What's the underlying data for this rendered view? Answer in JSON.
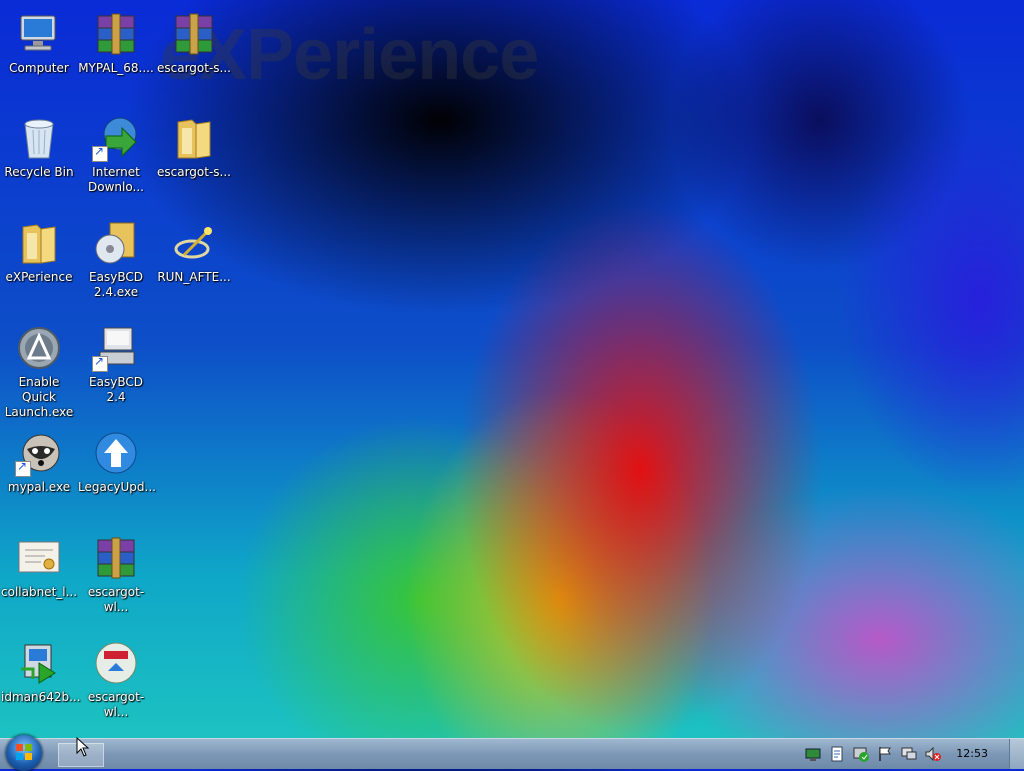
{
  "desktop": {
    "watermark": "eXPerience",
    "icons": [
      {
        "label": "Computer",
        "icon": "computer-icon"
      },
      {
        "label": "MYPAL_68....",
        "icon": "winrar-archive-icon"
      },
      {
        "label": "escargot-s...",
        "icon": "winrar-archive-icon"
      },
      {
        "label": "Recycle Bin",
        "icon": "recycle-bin-icon"
      },
      {
        "label": "Internet Downlo...",
        "icon": "internet-download-manager-icon"
      },
      {
        "label": "escargot-s...",
        "icon": "folder-icon"
      },
      {
        "label": "eXPerience",
        "icon": "folder-icon"
      },
      {
        "label": "EasyBCD 2.4.exe",
        "icon": "easybcd-installer-icon"
      },
      {
        "label": "RUN_AFTE...",
        "icon": "script-icon"
      },
      {
        "label": "Enable Quick Launch.exe",
        "icon": "quick-launch-icon"
      },
      {
        "label": "EasyBCD 2.4",
        "icon": "easybcd-icon"
      },
      {
        "label": "mypal.exe",
        "icon": "mypal-icon"
      },
      {
        "label": "LegacyUpd...",
        "icon": "legacy-update-icon"
      },
      {
        "label": "collabnet_l...",
        "icon": "certificate-icon"
      },
      {
        "label": "escargot-wl...",
        "icon": "winrar-archive-icon"
      },
      {
        "label": "idman642b...",
        "icon": "idm-installer-icon"
      },
      {
        "label": "escargot-wl...",
        "icon": "escargot-icon"
      }
    ]
  },
  "taskbar": {
    "start_icon": "windows-orb-icon",
    "tray_icons": [
      "network-icon",
      "document-icon",
      "security-icon",
      "flag-icon",
      "monitor-icon",
      "volume-muted-icon"
    ],
    "clock": "12:53"
  },
  "colors": {
    "taskbar": "#7d98b6",
    "label_text": "#ffffff"
  }
}
